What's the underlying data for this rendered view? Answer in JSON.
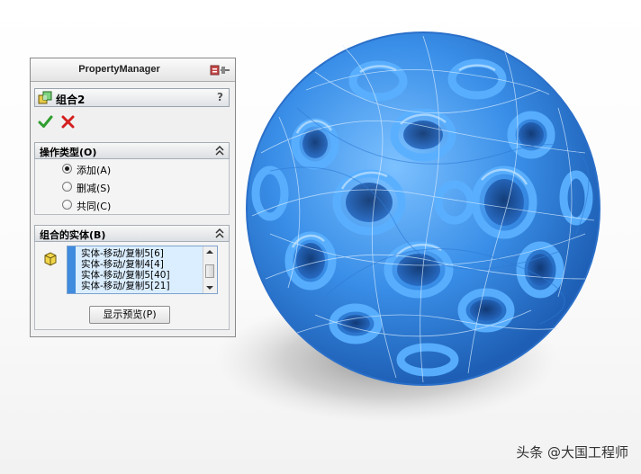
{
  "panel": {
    "title": "PropertyManager",
    "feature_name": "组合2",
    "help_label": "?",
    "operation_group": {
      "title": "操作类型(O)",
      "options": [
        {
          "label": "添加(A)",
          "checked": true
        },
        {
          "label": "删减(S)",
          "checked": false
        },
        {
          "label": "共同(C)",
          "checked": false
        }
      ]
    },
    "bodies_group": {
      "title": "组合的实体(B)",
      "items": [
        "实体-移动/复制5[6]",
        "实体-移动/复制4[4]",
        "实体-移动/复制5[40]",
        "实体-移动/复制5[21]"
      ]
    },
    "preview_button_label": "显示预览(P)"
  },
  "icons": {
    "ok": "checkmark-icon",
    "cancel": "x-icon",
    "pin": "pushpin-icon",
    "feature": "combine-feature-icon",
    "bodies": "solid-body-icon",
    "collapse": "double-chevron-up-icon"
  },
  "colors": {
    "model_blue": "#3a8fe8",
    "ok_green": "#2e9e2e",
    "cancel_red": "#d42020",
    "selection_bar": "#3f8bdd"
  },
  "watermark": "头条 @大国工程师"
}
